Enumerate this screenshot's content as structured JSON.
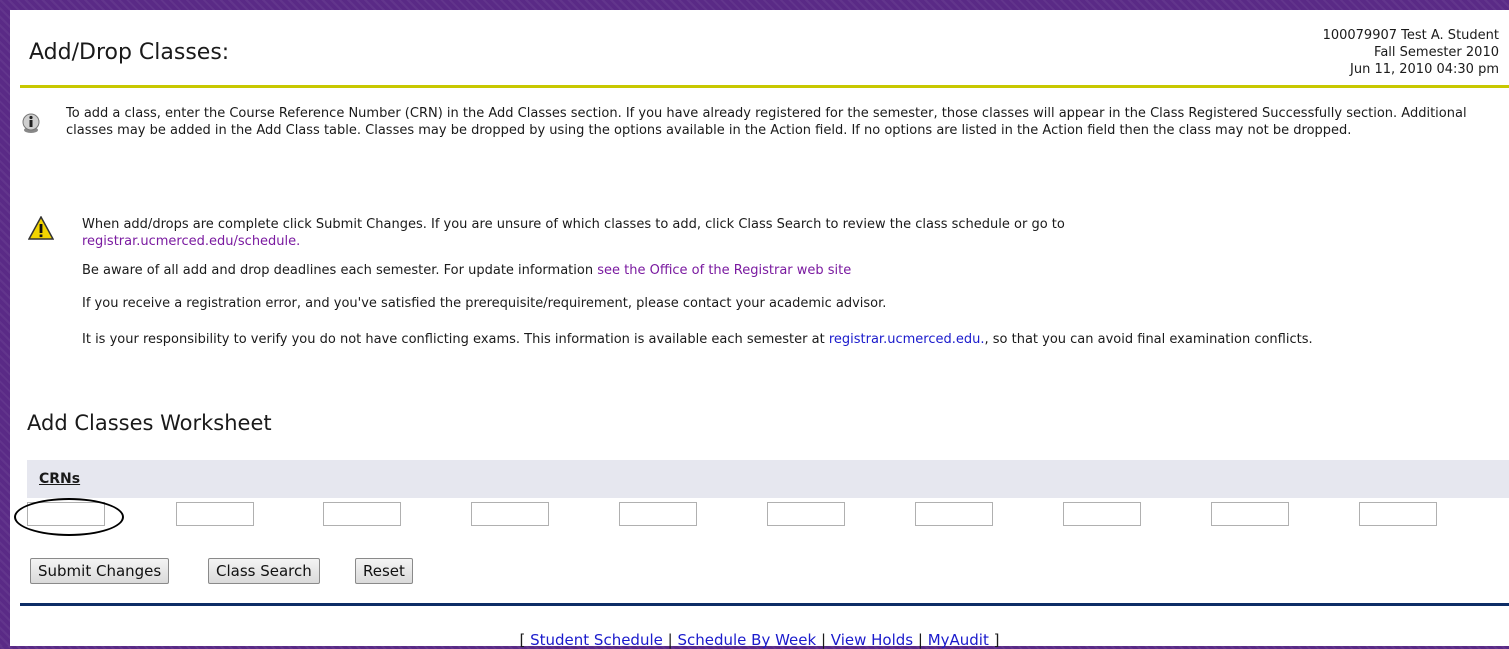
{
  "header": {
    "title": "Add/Drop Classes:",
    "student": "100079907 Test A. Student",
    "term": "Fall Semester 2010",
    "datetime": "Jun 11, 2010 04:30 pm"
  },
  "notes": {
    "info": "To add a class, enter the Course Reference Number (CRN) in the Add Classes section. If you have already registered for the semester, those classes will appear in the Class Registered Successfully section. Additional classes may be added in the Add Class table. Classes may be dropped by using the options available in the Action field. If no options are listed in the Action field then the class may not be dropped.",
    "warn_text": "When add/drops are complete click Submit Changes. If you are unsure of which classes to add, click Class Search to review the class schedule or go to",
    "warn_link": "registrar.ucmerced.edu/schedule.",
    "deadlines_text": "Be aware of all add and drop deadlines each semester. For update information ",
    "deadlines_link": "see the Office of the Registrar web site",
    "error_text": "If you receive a registration error, and you've satisfied the prerequisite/requirement, please contact your academic advisor.",
    "exams_text_a": "It is your responsibility to verify you do not have conflicting exams. This information is available each semester at ",
    "exams_link": "registrar.ucmerced.edu.",
    "exams_text_b": ", so that you can avoid final examination conflicts."
  },
  "worksheet": {
    "heading": "Add Classes Worksheet",
    "crn_label": "CRNs",
    "crn_values": [
      "",
      "",
      "",
      "",
      "",
      "",
      "",
      "",
      "",
      ""
    ]
  },
  "buttons": {
    "submit": "Submit Changes",
    "search": "Class Search",
    "reset": "Reset"
  },
  "footer": {
    "open": "[ ",
    "sep": " | ",
    "close": " ]",
    "links": [
      "Student Schedule",
      "Schedule By Week",
      "View Holds",
      "MyAudit"
    ]
  },
  "icons": {
    "info": "info-icon",
    "warning": "warning-icon"
  },
  "colors": {
    "header_rule": "#c8c800",
    "footer_rule": "#0d2d66",
    "link": "#1a1acc",
    "visited_link": "#7a1aa0",
    "crn_bar": "#e6e7ef"
  }
}
